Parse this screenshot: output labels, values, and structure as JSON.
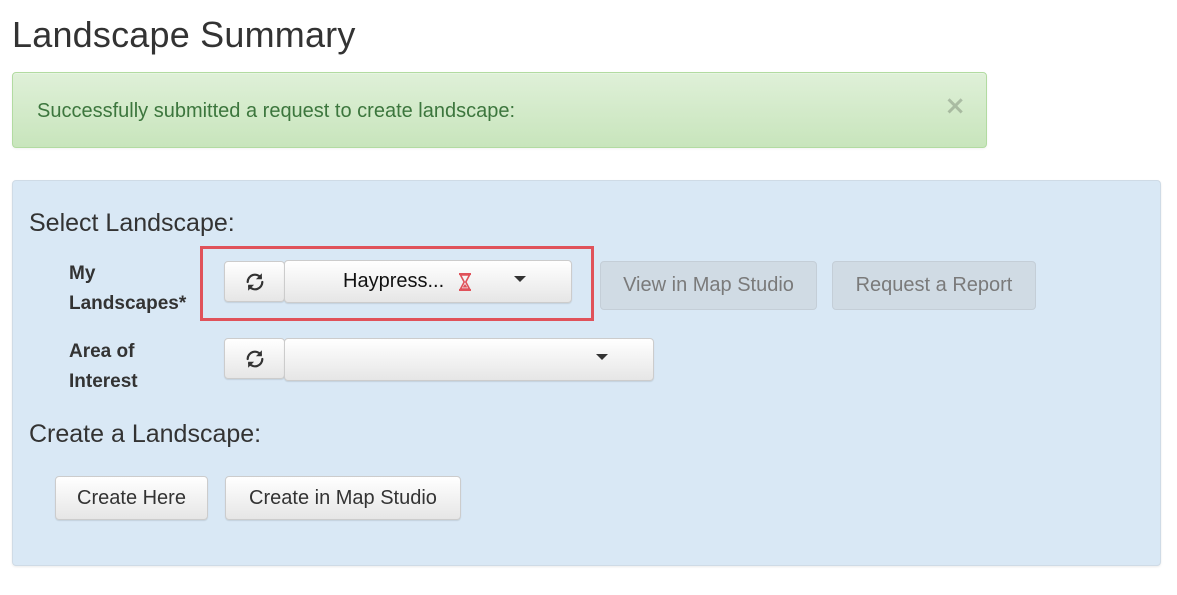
{
  "page": {
    "title": "Landscape Summary"
  },
  "alert": {
    "message": "Successfully submitted a request to create landscape:",
    "close_symbol": "×"
  },
  "select_section": {
    "heading": "Select Landscape:",
    "my_landscapes": {
      "label_line1": "My",
      "label_line2": "Landscapes*",
      "selected_value": "Haypress...",
      "status_icon": "hourglass-icon"
    },
    "area_of_interest": {
      "label_line1": "Area of",
      "label_line2": "Interest",
      "selected_value": ""
    },
    "view_button": "View in Map Studio",
    "report_button": "Request a Report"
  },
  "create_section": {
    "heading": "Create a Landscape:",
    "create_here_button": "Create Here",
    "create_map_studio_button": "Create in Map Studio"
  },
  "colors": {
    "alert_text": "#3c763d",
    "alert_background": "#dff0d8",
    "panel_background": "#d9e8f5",
    "highlight_border": "#e0525a",
    "hourglass": "#e0525a"
  }
}
